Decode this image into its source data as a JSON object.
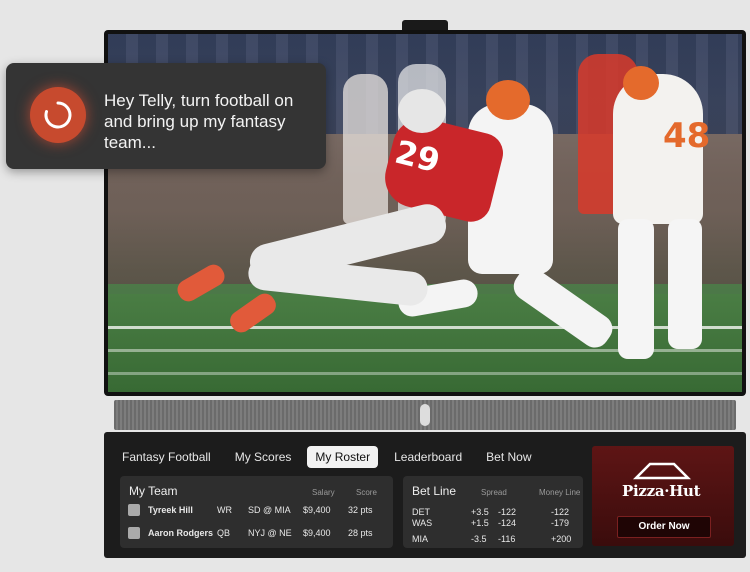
{
  "assistant": {
    "message": "Hey Telly, turn football on and bring up my fantasy team..."
  },
  "video": {
    "jersey_numbers": [
      "29",
      "48"
    ]
  },
  "tabs": [
    {
      "label": "Fantasy Football",
      "active": false
    },
    {
      "label": "My Scores",
      "active": false
    },
    {
      "label": "My Roster",
      "active": true
    },
    {
      "label": "Leaderboard",
      "active": false
    },
    {
      "label": "Bet Now",
      "active": false
    }
  ],
  "my_team": {
    "title": "My Team",
    "columns": {
      "salary": "Salary",
      "score": "Score"
    },
    "rows": [
      {
        "name": "Tyreek Hill",
        "pos": "WR",
        "game": "SD @ MIA",
        "salary": "$9,400",
        "score": "32 pts"
      },
      {
        "name": "Aaron Rodgers",
        "pos": "QB",
        "game": "NYJ @ NE",
        "salary": "$9,400",
        "score": "28 pts"
      }
    ]
  },
  "bet_line": {
    "title": "Bet Line",
    "columns": {
      "spread": "Spread",
      "money_line": "Money Line"
    },
    "rows": [
      {
        "team": "DET",
        "spread": "+3.5",
        "spread_odds": "-122",
        "money_line": "-122"
      },
      {
        "team": "WAS",
        "spread": "+1.5",
        "spread_odds": "-124",
        "money_line": "-179"
      },
      {
        "team": "MIA",
        "spread": "-3.5",
        "spread_odds": "-116",
        "money_line": "+200"
      }
    ]
  },
  "ad": {
    "brand": "Pizza·Hut",
    "button_label": "Order Now",
    "color": "#5e1515"
  },
  "colors": {
    "accent": "#c74a2e",
    "panel": "#1c1c1c",
    "card": "#2e2e2e"
  }
}
